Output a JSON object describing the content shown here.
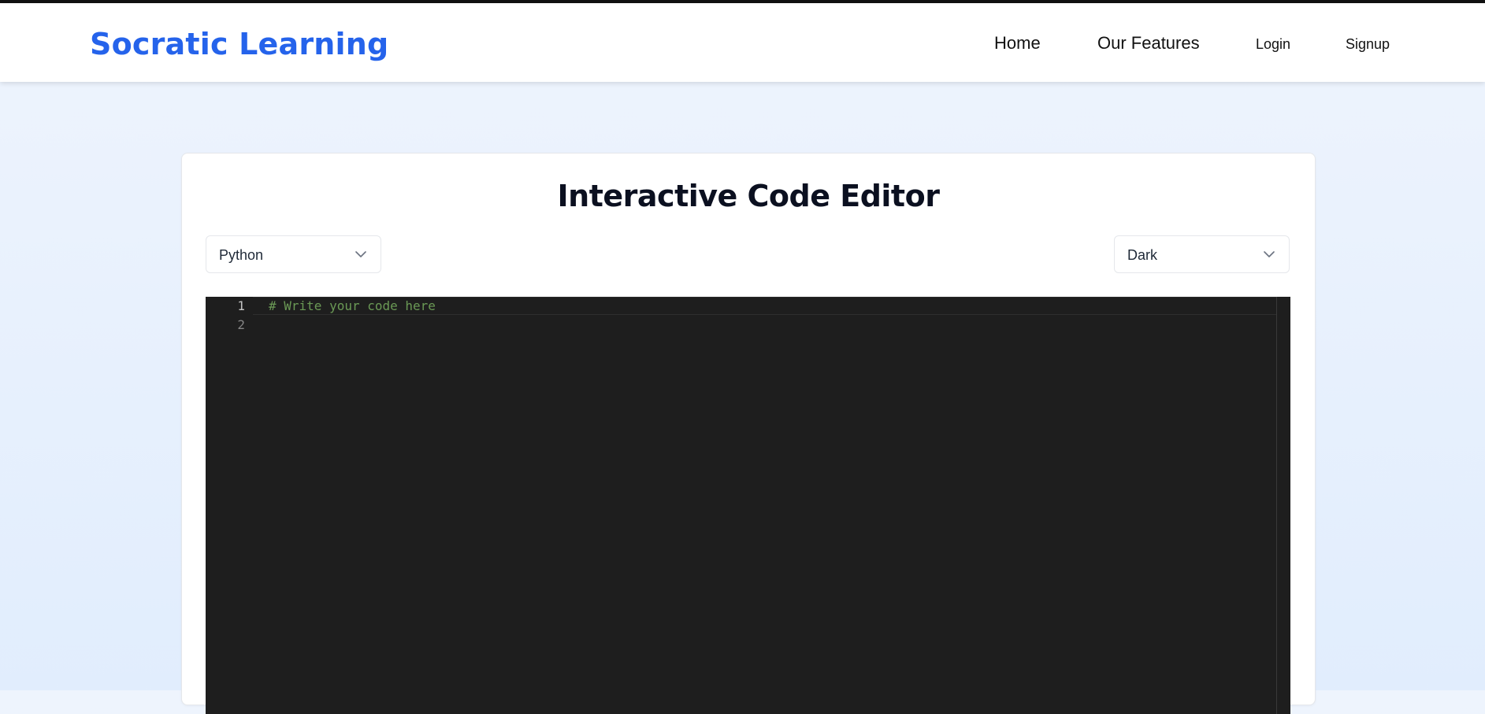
{
  "navbar": {
    "brand": "Socratic Learning",
    "links": {
      "home": "Home",
      "features": "Our Features",
      "login": "Login",
      "signup": "Signup"
    }
  },
  "editor_page": {
    "title": "Interactive Code Editor",
    "language_select": {
      "value": "Python",
      "icon": "chevron-down-icon"
    },
    "theme_select": {
      "value": "Dark",
      "icon": "chevron-down-icon"
    }
  },
  "code_editor": {
    "line_numbers": [
      "1",
      "2"
    ],
    "lines": [
      "# Write your code here",
      ""
    ]
  },
  "colors": {
    "brand": "#2563eb",
    "editor_background": "#1e1e1e",
    "comment": "#6a9955"
  }
}
